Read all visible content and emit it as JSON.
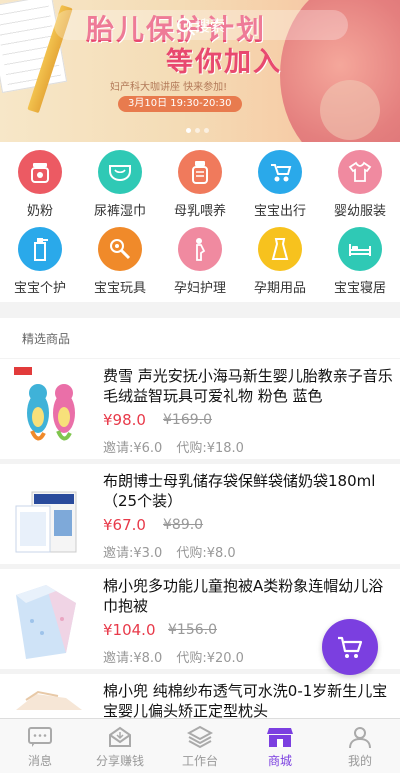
{
  "banner": {
    "search_label": "搜索",
    "title_line1": "胎儿保护计划",
    "title_line2": "等你加入",
    "subtitle": "妇产科大咖讲座 快来参加!",
    "date": "3月10日 19:30-20:30"
  },
  "categories": [
    {
      "label": "奶粉",
      "icon": "milk-powder-icon",
      "color": "#ec5a63"
    },
    {
      "label": "尿裤湿巾",
      "icon": "diaper-icon",
      "color": "#2fc9b5"
    },
    {
      "label": "母乳喂养",
      "icon": "breast-pump-icon",
      "color": "#f07a5c"
    },
    {
      "label": "宝宝出行",
      "icon": "stroller-icon",
      "color": "#2aa9ea"
    },
    {
      "label": "婴幼服装",
      "icon": "baby-clothes-icon",
      "color": "#f08aa0"
    },
    {
      "label": "宝宝个护",
      "icon": "lotion-bottle-icon",
      "color": "#2aa9ea"
    },
    {
      "label": "宝宝玩具",
      "icon": "rattle-toy-icon",
      "color": "#f08a2a"
    },
    {
      "label": "孕妇护理",
      "icon": "pregnant-woman-icon",
      "color": "#f08aa0"
    },
    {
      "label": "孕期用品",
      "icon": "maternity-dress-icon",
      "color": "#f7c21e"
    },
    {
      "label": "宝宝寝居",
      "icon": "baby-bed-icon",
      "color": "#2fc9b5"
    }
  ],
  "section_title": "精选商品",
  "products": [
    {
      "name": "费雪 声光安抚小海马新生婴儿胎教亲子音乐毛绒益智玩具可爱礼物 粉色 蓝色",
      "price": "¥98.0",
      "original_price": "¥169.0",
      "invite": "邀请:¥6.0",
      "purchase": "代购:¥18.0"
    },
    {
      "name": "布朗博士母乳储存袋保鲜袋储奶袋180ml（25个装）",
      "price": "¥67.0",
      "original_price": "¥89.0",
      "invite": "邀请:¥3.0",
      "purchase": "代购:¥8.0"
    },
    {
      "name": "棉小兜多功能儿童抱被A类粉象连帽幼儿浴巾抱被",
      "price": "¥104.0",
      "original_price": "¥156.0",
      "invite": "邀请:¥8.0",
      "purchase": "代购:¥20.0"
    },
    {
      "name": "棉小兜 纯棉纱布透气可水洗0-1岁新生儿宝宝婴儿偏头矫正定型枕头",
      "price": "",
      "original_price": "",
      "invite": "",
      "purchase": ""
    }
  ],
  "tabs": [
    {
      "label": "消息",
      "icon": "message-icon"
    },
    {
      "label": "分享赚钱",
      "icon": "share-money-icon"
    },
    {
      "label": "工作台",
      "icon": "workbench-layers-icon"
    },
    {
      "label": "商城",
      "icon": "mall-store-icon",
      "active": true
    },
    {
      "label": "我的",
      "icon": "profile-icon"
    }
  ],
  "colors": {
    "accent": "#7b3fe0",
    "price": "#e83a4a"
  }
}
